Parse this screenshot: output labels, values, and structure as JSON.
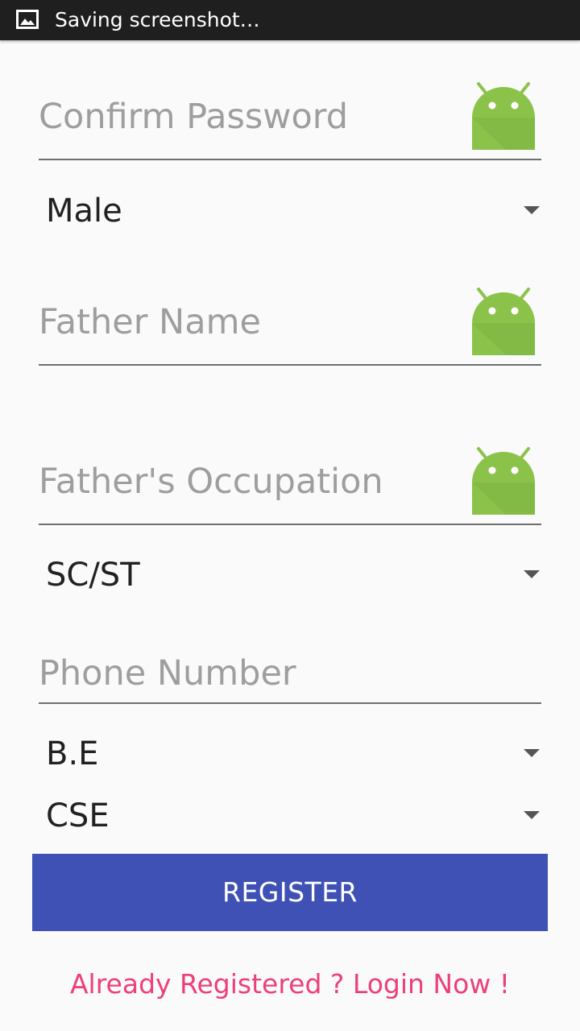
{
  "status_bar": {
    "notification_text": "Saving screenshot…",
    "notification_icon": "image-icon"
  },
  "form": {
    "confirm_password": {
      "placeholder": "Confirm Password",
      "value": ""
    },
    "gender": {
      "selected": "Male"
    },
    "father_name": {
      "placeholder": "Father Name",
      "value": ""
    },
    "father_occupation": {
      "placeholder": "Father's Occupation",
      "value": ""
    },
    "category": {
      "selected": "SC/ST"
    },
    "phone_number": {
      "placeholder": "Phone Number",
      "value": ""
    },
    "degree": {
      "selected": "B.E"
    },
    "branch": {
      "selected": "CSE"
    }
  },
  "actions": {
    "register_label": "REGISTER",
    "login_link": "Already Registered ? Login Now !"
  },
  "colors": {
    "primary": "#3f51b5",
    "accent": "#ec407a",
    "android_green": "#8bc34a"
  }
}
